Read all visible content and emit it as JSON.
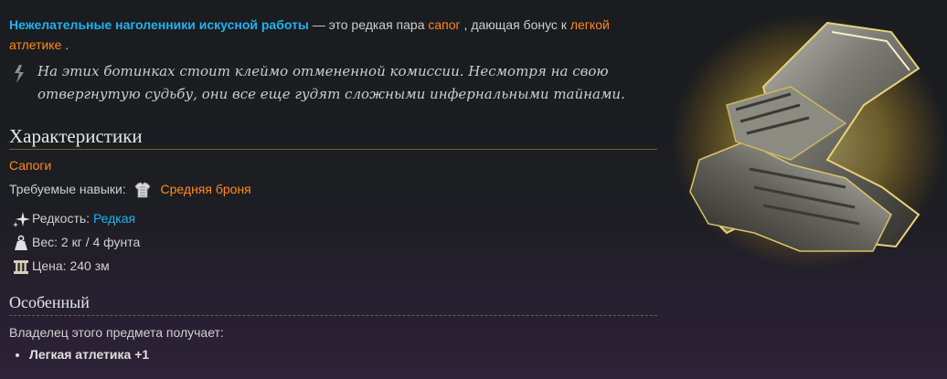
{
  "intro": {
    "item_name": "Нежелательные наголенники искусной работы",
    "text1": " — это редкая пара ",
    "link1": "сапог",
    "text2": " , дающая бонус к ",
    "link2": "легкой атлетике",
    "text3": " ."
  },
  "quote": {
    "icon": "quote-mark-icon",
    "text": "На этих ботинках стоит клеймо отмененной комиссии. Несмотря на свою отвергнутую судьбу, они все еще гудят сложными инфернальными тайнами."
  },
  "characteristics": {
    "heading": "Характеристики",
    "type_link": "Сапоги",
    "skills_label": "Требуемые навыки:",
    "skills_icon": "medium-armor-icon",
    "skills_link": "Средняя броня",
    "rarity_label": "Редкость:",
    "rarity_value": "Редкая",
    "weight_text": "Вес: 2 кг / 4 фунта",
    "price_text": "Цена: 240 зм"
  },
  "special": {
    "heading": "Особенный",
    "owner_text": "Владелец этого предмета получает:",
    "bonuses": [
      "Легкая атлетика +1"
    ]
  },
  "colors": {
    "link_blue": "#1fb2f0",
    "link_orange": "#ff8a1c",
    "header_line": "#7a5a2b"
  }
}
